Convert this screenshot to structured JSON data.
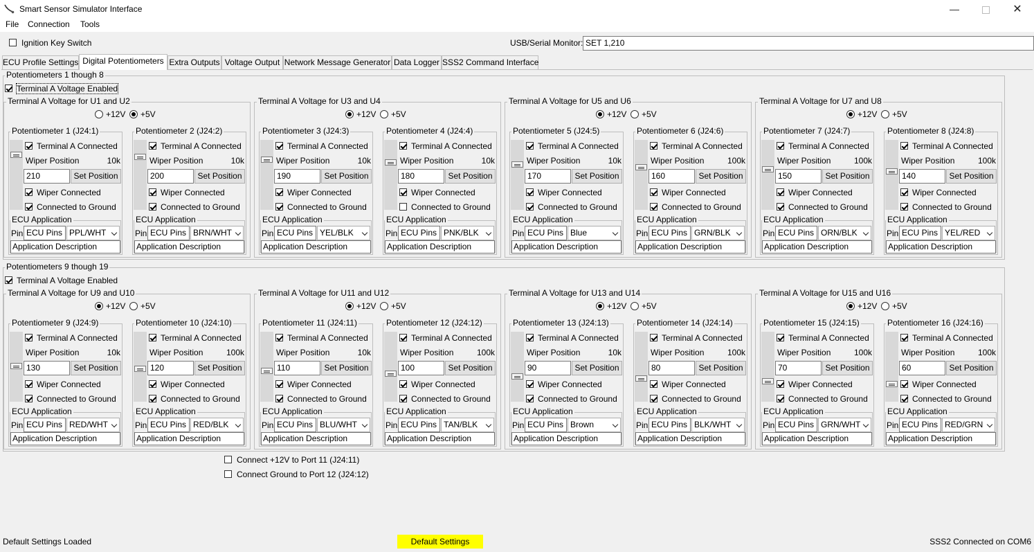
{
  "window": {
    "title": "Smart Sensor Simulator Interface",
    "app_icon": "stethoscope-icon",
    "min_icon": "minimize-icon",
    "max_icon": "maximize-icon",
    "close_icon": "close-icon"
  },
  "menu": [
    "File",
    "Connection",
    "Tools"
  ],
  "top": {
    "ignition_label": "Ignition Key Switch",
    "ignition_checked": false,
    "monitor_label": "USB/Serial Monitor:",
    "monitor_value": "SET 1,210"
  },
  "tabs": [
    "ECU Profile Settings",
    "Digital Potentiometers",
    "Extra Outputs",
    "Voltage Output",
    "Network Message Generator",
    "Data Logger",
    "SSS2 Command Interface"
  ],
  "active_tab": 1,
  "groups": [
    {
      "title": "Potentiometers 1 though 8",
      "enable_label": "Terminal A Voltage Enabled",
      "enabled": true,
      "pairs": [
        {
          "title": "Terminal A Voltage for U1 and U2",
          "options": [
            "+12V",
            "+5V"
          ],
          "selected": "+5V"
        },
        {
          "title": "Terminal A Voltage for U3 and U4",
          "options": [
            "+12V",
            "+5V"
          ],
          "selected": "+12V"
        },
        {
          "title": "Terminal A Voltage for U5 and U6",
          "options": [
            "+12V",
            "+5V"
          ],
          "selected": "+12V"
        },
        {
          "title": "Terminal A Voltage for U7 and U8",
          "options": [
            "+12V",
            "+5V"
          ],
          "selected": "+12V"
        }
      ],
      "pots": [
        {
          "title": "Potentiometer 1 (J24:1)",
          "terminal_label": "Terminal A Connected",
          "terminal": true,
          "wiper_label": "Wiper Position",
          "range": "10k",
          "value": "210",
          "set_label": "Set Position",
          "wiper_conn_label": "Wiper Connected",
          "wiper_conn": true,
          "ground_label": "Connected to Ground",
          "ground": true,
          "ecu_label": "ECU Application",
          "pin_label": "Pin",
          "pins": "ECU Pins",
          "wire": "PPL/WHT",
          "desc": "Application Description",
          "level": 0.82
        },
        {
          "title": "Potentiometer 2 (J24:2)",
          "terminal_label": "Terminal A Connected",
          "terminal": true,
          "wiper_label": "Wiper Position",
          "range": "10k",
          "value": "200",
          "set_label": "Set Position",
          "wiper_conn_label": "Wiper Connected",
          "wiper_conn": true,
          "ground_label": "Connected to Ground",
          "ground": true,
          "ecu_label": "ECU Application",
          "pin_label": "Pin",
          "pins": "ECU Pins",
          "wire": "BRN/WHT",
          "desc": "Application Description",
          "level": 0.78
        },
        {
          "title": "Potentiometer 3 (J24:3)",
          "terminal_label": "Terminal A Connected",
          "terminal": true,
          "wiper_label": "Wiper Position",
          "range": "10k",
          "value": "190",
          "set_label": "Set Position",
          "wiper_conn_label": "Wiper Connected",
          "wiper_conn": true,
          "ground_label": "Connected to Ground",
          "ground": true,
          "ecu_label": "ECU Application",
          "pin_label": "Pin",
          "pins": "ECU Pins",
          "wire": "YEL/BLK",
          "desc": "Application Description",
          "level": 0.74
        },
        {
          "title": "Potentiometer 4 (J24:4)",
          "terminal_label": "Terminal A Connected",
          "terminal": true,
          "wiper_label": "Wiper Position",
          "range": "10k",
          "value": "180",
          "set_label": "Set Position",
          "wiper_conn_label": "Wiper Connected",
          "wiper_conn": true,
          "ground_label": "Connected to Ground",
          "ground": false,
          "ecu_label": "ECU Application",
          "pin_label": "Pin",
          "pins": "ECU Pins",
          "wire": "PNK/BLK",
          "desc": "Application Description",
          "level": 0.7
        },
        {
          "title": "Potentiometer 5 (J24:5)",
          "terminal_label": "Terminal A Connected",
          "terminal": true,
          "wiper_label": "Wiper Position",
          "range": "10k",
          "value": "170",
          "set_label": "Set Position",
          "wiper_conn_label": "Wiper Connected",
          "wiper_conn": true,
          "ground_label": "Connected to Ground",
          "ground": true,
          "ecu_label": "ECU Application",
          "pin_label": "Pin",
          "pins": "ECU Pins",
          "wire": "Blue",
          "desc": "Application Description",
          "level": 0.66
        },
        {
          "title": "Potentiometer 6 (J24:6)",
          "terminal_label": "Terminal A Connected",
          "terminal": true,
          "wiper_label": "Wiper Position",
          "range": "100k",
          "value": "160",
          "set_label": "Set Position",
          "wiper_conn_label": "Wiper Connected",
          "wiper_conn": true,
          "ground_label": "Connected to Ground",
          "ground": true,
          "ecu_label": "ECU Application",
          "pin_label": "Pin",
          "pins": "ECU Pins",
          "wire": "GRN/BLK",
          "desc": "Application Description",
          "level": 0.62
        },
        {
          "title": "Potentiometer 7 (J24:7)",
          "terminal_label": "Terminal A Connected",
          "terminal": true,
          "wiper_label": "Wiper Position",
          "range": "100k",
          "value": "150",
          "set_label": "Set Position",
          "wiper_conn_label": "Wiper Connected",
          "wiper_conn": true,
          "ground_label": "Connected to Ground",
          "ground": true,
          "ecu_label": "ECU Application",
          "pin_label": "Pin",
          "pins": "ECU Pins",
          "wire": "ORN/BLK",
          "desc": "Application Description",
          "level": 0.59
        },
        {
          "title": "Potentiometer 8 (J24:8)",
          "terminal_label": "Terminal A Connected",
          "terminal": true,
          "wiper_label": "Wiper Position",
          "range": "100k",
          "value": "140",
          "set_label": "Set Position",
          "wiper_conn_label": "Wiper Connected",
          "wiper_conn": true,
          "ground_label": "Connected to Ground",
          "ground": true,
          "ecu_label": "ECU Application",
          "pin_label": "Pin",
          "pins": "ECU Pins",
          "wire": "YEL/RED",
          "desc": "Application Description",
          "level": 0.55
        }
      ]
    },
    {
      "title": "Potentiometers 9 though 19",
      "enable_label": "Terminal A Voltage Enabled",
      "enabled": true,
      "pairs": [
        {
          "title": "Terminal A Voltage for U9 and U10",
          "options": [
            "+12V",
            "+5V"
          ],
          "selected": "+12V"
        },
        {
          "title": "Terminal A Voltage for U11 and U12",
          "options": [
            "+12V",
            "+5V"
          ],
          "selected": "+12V"
        },
        {
          "title": "Terminal A Voltage for U13 and U14",
          "options": [
            "+12V",
            "+5V"
          ],
          "selected": "+12V"
        },
        {
          "title": "Terminal A Voltage for U15 and U16",
          "options": [
            "+12V",
            "+5V"
          ],
          "selected": "+12V"
        }
      ],
      "pots": [
        {
          "title": "Potentiometer  9 (J24:9)",
          "terminal_label": "Terminal A Connected",
          "terminal": true,
          "wiper_label": "Wiper Position",
          "range": "10k",
          "value": "130",
          "set_label": "Set Position",
          "wiper_conn_label": "Wiper Connected",
          "wiper_conn": true,
          "ground_label": "Connected to Ground",
          "ground": true,
          "ecu_label": "ECU Application",
          "pin_label": "Pin",
          "pins": "ECU Pins",
          "wire": "RED/WHT",
          "desc": "Application Description",
          "level": 0.51
        },
        {
          "title": "Potentiometer 10 (J24:10)",
          "terminal_label": "Terminal A Connected",
          "terminal": true,
          "wiper_label": "Wiper Position",
          "range": "100k",
          "value": "120",
          "set_label": "Set Position",
          "wiper_conn_label": "Wiper Connected",
          "wiper_conn": true,
          "ground_label": "Connected to Ground",
          "ground": true,
          "ecu_label": "ECU Application",
          "pin_label": "Pin",
          "pins": "ECU Pins",
          "wire": "RED/BLK",
          "desc": "Application Description",
          "level": 0.47
        },
        {
          "title": "Potentiometer 11 (J24:11)",
          "terminal_label": "Terminal A Connected",
          "terminal": true,
          "wiper_label": "Wiper Position",
          "range": "10k",
          "value": "110",
          "set_label": "Set Position",
          "wiper_conn_label": "Wiper Connected",
          "wiper_conn": true,
          "ground_label": "Connected to Ground",
          "ground": true,
          "ecu_label": "ECU Application",
          "pin_label": "Pin",
          "pins": "ECU Pins",
          "wire": "BLU/WHT",
          "desc": "Application Description",
          "level": 0.43
        },
        {
          "title": "Potentiometer 12 (J24:12)",
          "terminal_label": "Terminal A Connected",
          "terminal": true,
          "wiper_label": "Wiper Position",
          "range": "100k",
          "value": "100",
          "set_label": "Set Position",
          "wiper_conn_label": "Wiper Connected",
          "wiper_conn": true,
          "ground_label": "Connected to Ground",
          "ground": true,
          "ecu_label": "ECU Application",
          "pin_label": "Pin",
          "pins": "ECU Pins",
          "wire": "TAN/BLK",
          "desc": "Application Description",
          "level": 0.39
        },
        {
          "title": "Potentiometer 13 (J24:13)",
          "terminal_label": "Terminal A Connected",
          "terminal": true,
          "wiper_label": "Wiper Position",
          "range": "10k",
          "value": "90",
          "set_label": "Set Position",
          "wiper_conn_label": "Wiper Connected",
          "wiper_conn": true,
          "ground_label": "Connected to Ground",
          "ground": true,
          "ecu_label": "ECU Application",
          "pin_label": "Pin",
          "pins": "ECU Pins",
          "wire": "Brown",
          "desc": "Application Description",
          "level": 0.35
        },
        {
          "title": "Potentiometer 14 (J24:14)",
          "terminal_label": "Terminal A Connected",
          "terminal": true,
          "wiper_label": "Wiper Position",
          "range": "100k",
          "value": "80",
          "set_label": "Set Position",
          "wiper_conn_label": "Wiper Connected",
          "wiper_conn": true,
          "ground_label": "Connected to Ground",
          "ground": true,
          "ecu_label": "ECU Application",
          "pin_label": "Pin",
          "pins": "ECU Pins",
          "wire": "BLK/WHT",
          "desc": "Application Description",
          "level": 0.31
        },
        {
          "title": "Potentiometer 15 (J24:15)",
          "terminal_label": "Terminal A Connected",
          "terminal": true,
          "wiper_label": "Wiper Position",
          "range": "100k",
          "value": "70",
          "set_label": "Set Position",
          "wiper_conn_label": "Wiper Connected",
          "wiper_conn": true,
          "ground_label": "Connected to Ground",
          "ground": true,
          "ecu_label": "ECU Application",
          "pin_label": "Pin",
          "pins": "ECU Pins",
          "wire": "GRN/WHT",
          "desc": "Application Description",
          "level": 0.27
        },
        {
          "title": "Potentiometer 16 (J24:16)",
          "terminal_label": "Terminal A Connected",
          "terminal": true,
          "wiper_label": "Wiper Position",
          "range": "100k",
          "value": "60",
          "set_label": "Set Position",
          "wiper_conn_label": "Wiper Connected",
          "wiper_conn": true,
          "ground_label": "Connected to Ground",
          "ground": true,
          "ecu_label": "ECU Application",
          "pin_label": "Pin",
          "pins": "ECU Pins",
          "wire": "RED/GRN",
          "desc": "Application Description",
          "level": 0.23
        }
      ]
    }
  ],
  "extras": [
    {
      "label": "Connect +12V to Port 11 (J24:11)",
      "checked": false
    },
    {
      "label": "Connect Ground to Port 12 (J24:12)",
      "checked": false
    }
  ],
  "status": {
    "left": "Default Settings Loaded",
    "center": "Default Settings",
    "right": "SSS2 Connected on COM6",
    "center_color": "#ffff00"
  }
}
